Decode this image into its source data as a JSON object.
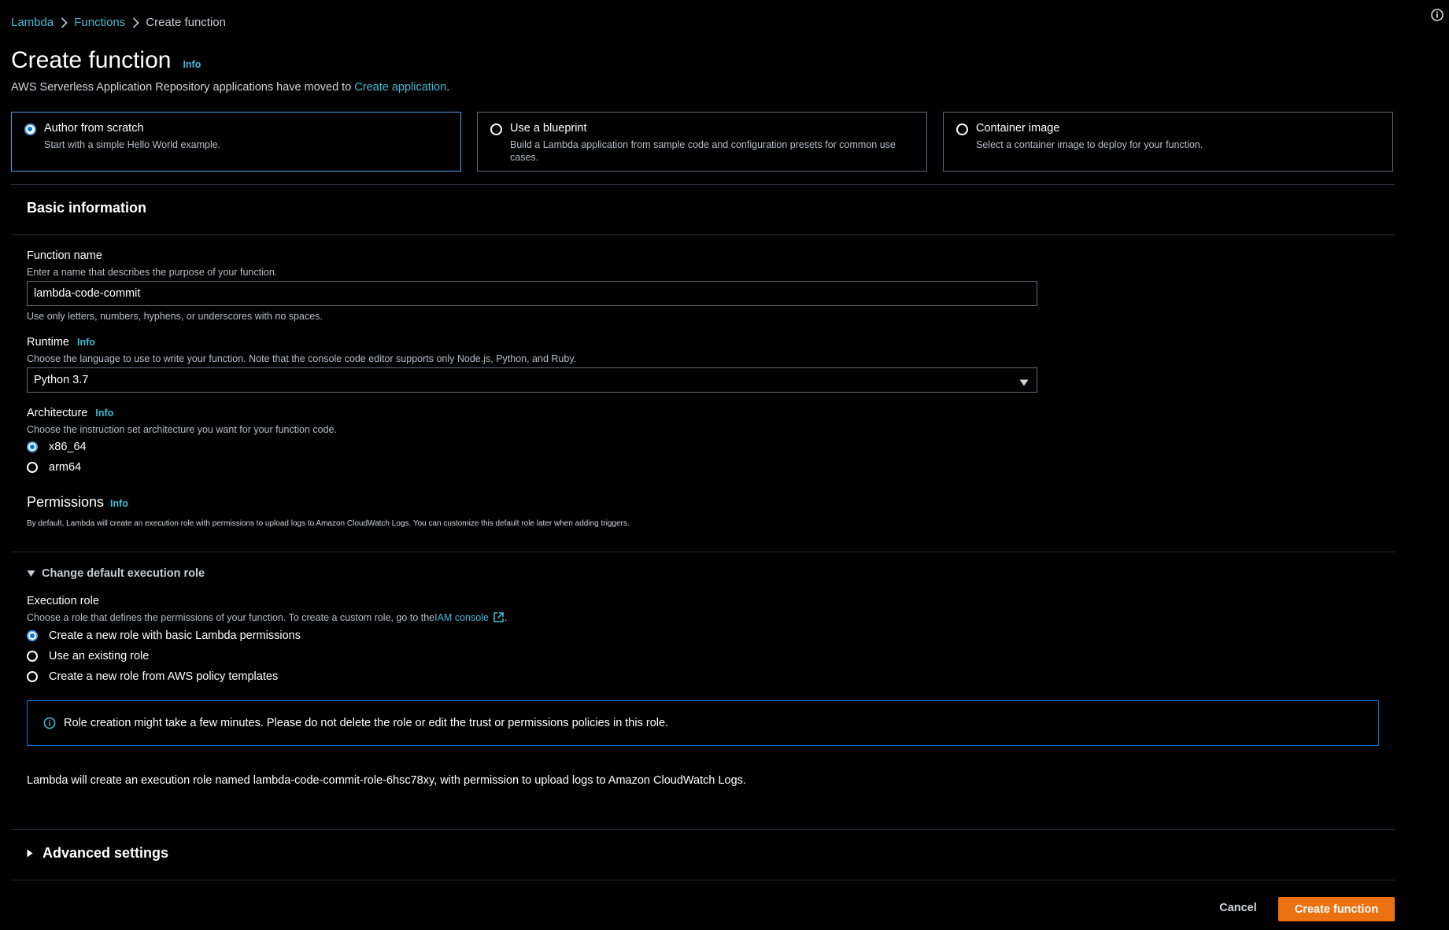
{
  "breadcrumb": {
    "items": [
      "Lambda",
      "Functions",
      "Create function"
    ]
  },
  "page": {
    "title": "Create function",
    "info": "Info",
    "moved_text": "AWS Serverless Application Repository applications have moved to ",
    "moved_link": "Create application",
    "moved_end": "."
  },
  "options": [
    {
      "title": "Author from scratch",
      "desc": "Start with a simple Hello World example.",
      "selected": true
    },
    {
      "title": "Use a blueprint",
      "desc": "Build a Lambda application from sample code and configuration presets for common use cases.",
      "selected": false
    },
    {
      "title": "Container image",
      "desc": "Select a container image to deploy for your function.",
      "selected": false
    }
  ],
  "basic": {
    "title": "Basic information",
    "function_name": {
      "label": "Function name",
      "desc": "Enter a name that describes the purpose of your function.",
      "value": "lambda-code-commit",
      "hint": "Use only letters, numbers, hyphens, or underscores with no spaces."
    },
    "runtime": {
      "label": "Runtime",
      "info": "Info",
      "desc": "Choose the language to use to write your function. Note that the console code editor supports only Node.js, Python, and Ruby.",
      "value": "Python 3.7"
    },
    "architecture": {
      "label": "Architecture",
      "info": "Info",
      "desc": "Choose the instruction set architecture you want for your function code.",
      "options": [
        "x86_64",
        "arm64"
      ],
      "selected": "x86_64"
    },
    "permissions": {
      "label": "Permissions",
      "info": "Info",
      "desc": "By default, Lambda will create an execution role with permissions to upload logs to Amazon CloudWatch Logs. You can customize this default role later when adding triggers."
    }
  },
  "execution": {
    "expander": "Change default execution role",
    "label": "Execution role",
    "desc_prefix": "Choose a role that defines the permissions of your function. To create a custom role, go to the ",
    "desc_link": "IAM console",
    "desc_suffix": ".",
    "options": [
      "Create a new role with basic Lambda permissions",
      "Use an existing role",
      "Create a new role from AWS policy templates"
    ],
    "alert": "Role creation might take a few minutes. Please do not delete the role or edit the trust or permissions policies in this role.",
    "note": "Lambda will create an execution role named lambda-code-commit-role-6hsc78xy, with permission to upload logs to Amazon CloudWatch Logs."
  },
  "advanced": {
    "label": "Advanced settings"
  },
  "footer": {
    "cancel": "Cancel",
    "create": "Create function"
  },
  "colors": {
    "link": "#44b9d6",
    "primary_button": "#ec7211",
    "selected_border": "#539fe5",
    "alert_border": "#0972d3"
  }
}
